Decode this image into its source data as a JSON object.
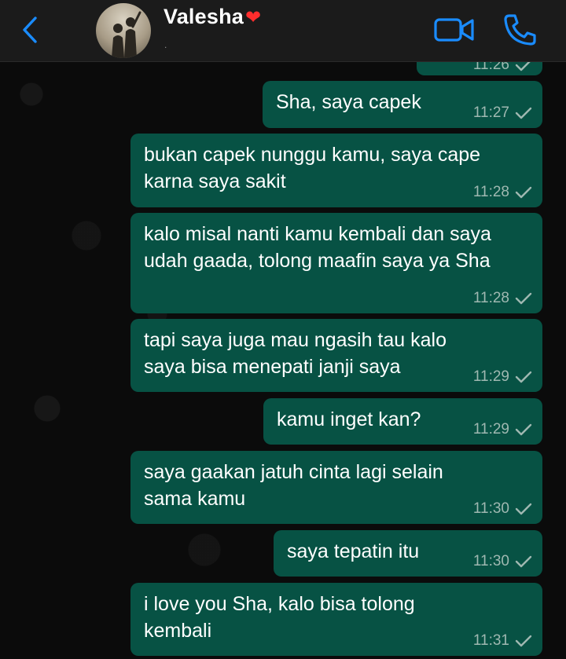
{
  "header": {
    "name": "Valesha",
    "name_emoji": "❤",
    "status": "."
  },
  "top_partial_time": "11:26",
  "messages": [
    {
      "text": "Sha, saya capek",
      "time": "11:27"
    },
    {
      "text": "bukan capek nunggu kamu, saya cape\nkarna saya sakit",
      "time": "11:28"
    },
    {
      "text": "kalo misal nanti kamu kembali dan saya\nudah gaada, tolong maafin saya ya Sha",
      "time": "11:28"
    },
    {
      "text": "tapi saya juga mau ngasih tau kalo\nsaya bisa menepati janji saya",
      "time": "11:29"
    },
    {
      "text": "kamu inget kan?",
      "time": "11:29"
    },
    {
      "text": "saya gaakan jatuh cinta lagi selain\nsama kamu",
      "time": "11:30"
    },
    {
      "text": "saya tepatin itu",
      "time": "11:30"
    },
    {
      "text": "i love you Sha, kalo bisa tolong\nkembali",
      "time": "11:31"
    }
  ],
  "colors": {
    "accent": "#1a8cff",
    "outgoing_bubble": "#075244",
    "header_bg": "#1b1b1b",
    "chat_bg": "#0b0b0b"
  },
  "icons": {
    "back": "chevron-left-icon",
    "video": "video-camera-icon",
    "call": "phone-icon",
    "status": "sent-check-icon"
  }
}
